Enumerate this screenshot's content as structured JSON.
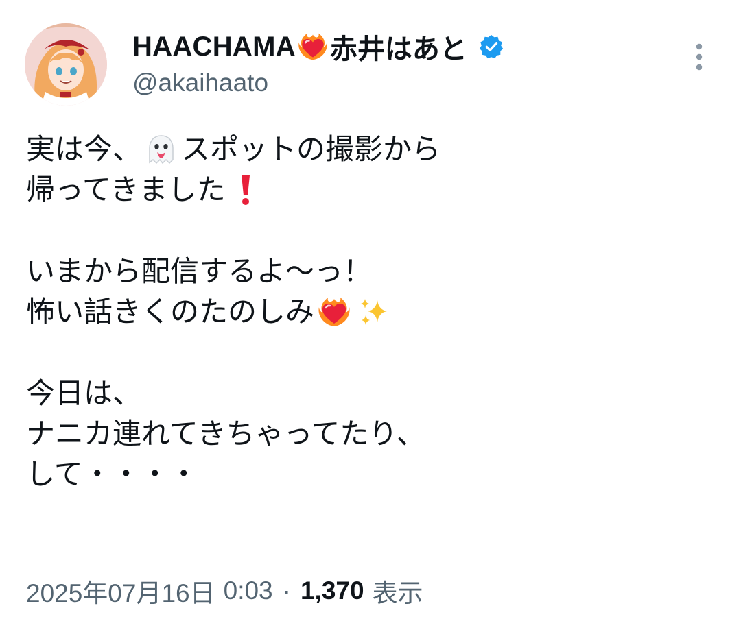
{
  "author": {
    "display_name": "HAACHAMA",
    "display_name_emoji": "heart-on-fire",
    "display_name_jp": "赤井はあと",
    "verified_badge": "verified-badge-icon",
    "handle": "@akaihaato"
  },
  "menu": {
    "more_icon": "more-vertical-icon"
  },
  "tweet": {
    "lines": [
      {
        "segments": [
          {
            "text": "実は今、"
          },
          {
            "emoji": "ghost"
          },
          {
            "text": "スポットの撮影から"
          }
        ]
      },
      {
        "segments": [
          {
            "text": "帰ってきました"
          },
          {
            "emoji": "exclamation"
          }
        ]
      },
      {
        "segments": []
      },
      {
        "segments": [
          {
            "text": "いまから配信するよ〜っ！"
          }
        ]
      },
      {
        "segments": [
          {
            "text": "怖い話きくのたのしみ"
          },
          {
            "emoji": "heart-on-fire"
          },
          {
            "emoji": "sparkles"
          }
        ]
      },
      {
        "segments": []
      },
      {
        "segments": [
          {
            "text": "今日は、"
          }
        ]
      },
      {
        "segments": [
          {
            "text": "ナニカ連れてきちゃってたり、"
          }
        ]
      },
      {
        "segments": [
          {
            "text": "して・・・・"
          }
        ]
      }
    ]
  },
  "meta": {
    "date": "2025年07月16日",
    "time": "0:03",
    "separator": "·",
    "views_count": "1,370",
    "views_label": "表示"
  },
  "colors": {
    "text": "#0f1419",
    "secondary": "#536471",
    "verified_blue": "#1d9bf0",
    "heart_red": "#e8203a",
    "fire_orange": "#ff8a1f"
  }
}
